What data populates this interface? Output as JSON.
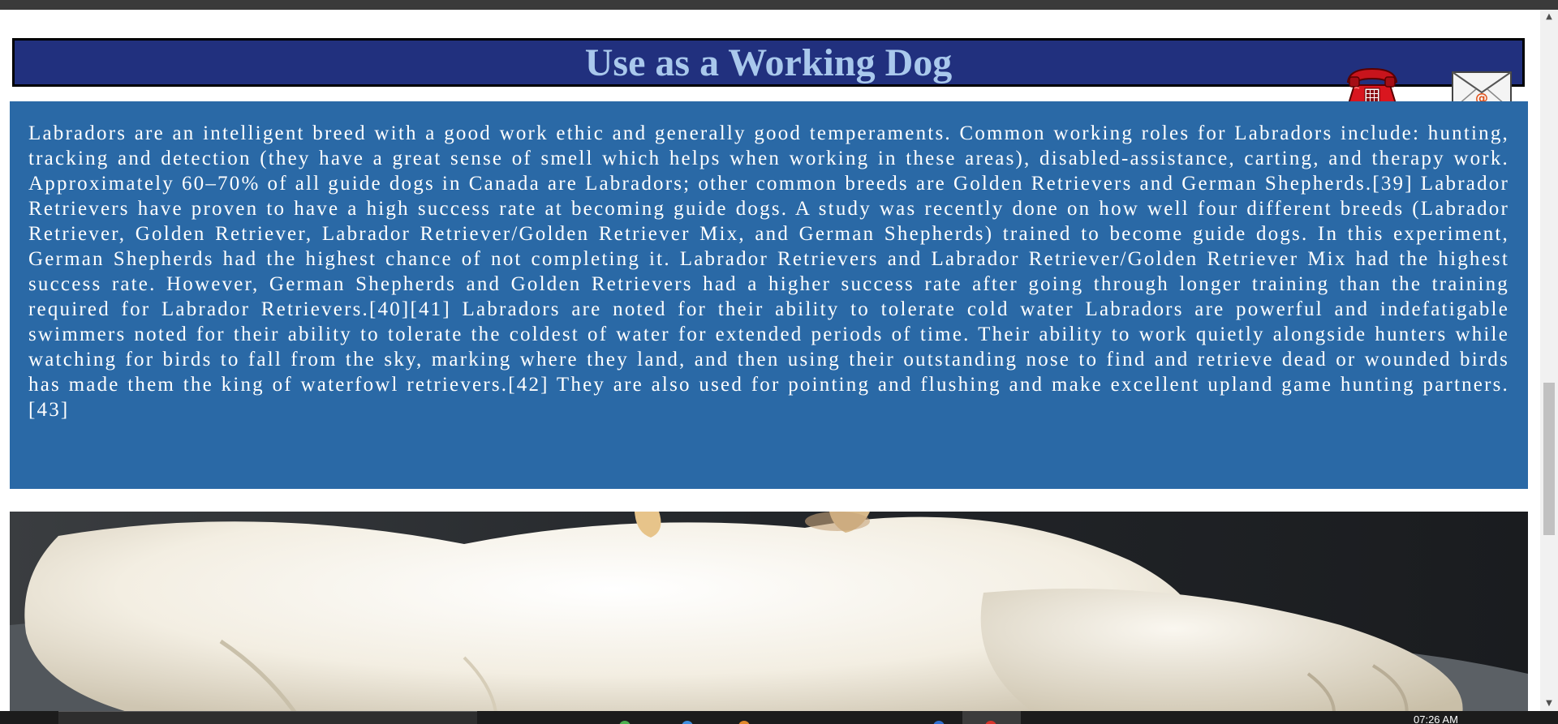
{
  "section": {
    "title": "Use as a Working Dog"
  },
  "contact_icons": {
    "phone": "telephone-icon",
    "mail": "email-icon"
  },
  "article": {
    "paragraph": "Labradors are an intelligent breed with a good work ethic and generally good temperaments. Common working roles for Labradors include: hunting, tracking and detection (they have a great sense of smell which helps when working in these areas), disabled-assistance, carting, and therapy work. Approximately 60–70% of all guide dogs in Canada are Labradors; other common breeds are Golden Retrievers and German Shepherds.[39] Labrador Retrievers have proven to have a high success rate at becoming guide dogs. A study was recently done on how well four different breeds (Labrador Retriever, Golden Retriever, Labrador Retriever/Golden Retriever Mix, and German Shepherds) trained to become guide dogs. In this experiment, German Shepherds had the highest chance of not completing it. Labrador Retrievers and Labrador Retriever/Golden Retriever Mix had the highest success rate. However, German Shepherds and Golden Retrievers had a higher success rate after going through longer training than the training required for Labrador Retrievers.[40][41] Labradors are noted for their ability to tolerate cold water Labradors are powerful and indefatigable swimmers noted for their ability to tolerate the coldest of water for extended periods of time. Their ability to work quietly alongside hunters while watching for birds to fall from the sky, marking where they land, and then using their outstanding nose to find and retrieve dead or wounded birds has made them the king of waterfowl retrievers.[42] They are also used for pointing and flushing and make excellent upland game hunting partners.[43]"
  },
  "image": {
    "subject": "labrador-puppy-photo"
  },
  "taskbar": {
    "clock": "07:26 AM"
  },
  "colors": {
    "banner_bg": "#21307e",
    "banner_text": "#a9c8ec",
    "content_bg": "#2a69a6",
    "content_text": "#ffffff"
  }
}
